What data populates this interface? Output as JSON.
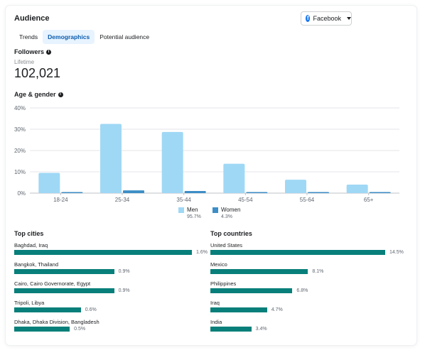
{
  "header": {
    "title": "Audience",
    "source_selector": "Facebook"
  },
  "tabs": [
    {
      "label": "Trends",
      "active": false
    },
    {
      "label": "Demographics",
      "active": true
    },
    {
      "label": "Potential audience",
      "active": false
    }
  ],
  "followers": {
    "title": "Followers",
    "period": "Lifetime",
    "count": "102,021"
  },
  "age_gender": {
    "title": "Age & gender"
  },
  "chart_data": {
    "type": "bar",
    "categories": [
      "18-24",
      "25-34",
      "35-44",
      "45-54",
      "55-64",
      "65+"
    ],
    "series": [
      {
        "name": "Men",
        "values": [
          9.5,
          32.5,
          28.7,
          13.8,
          6.3,
          4.0
        ],
        "color": "#9fd8f5",
        "total": "95.7%"
      },
      {
        "name": "Women",
        "values": [
          0.5,
          1.3,
          1.0,
          0.5,
          0.25,
          0.25
        ],
        "color": "#3d8ec6",
        "total": "4.3%"
      }
    ],
    "yticks": [
      "0%",
      "10%",
      "20%",
      "30%",
      "40%"
    ],
    "ylim": [
      0,
      40
    ],
    "grid": true
  },
  "top_cities": {
    "title": "Top cities",
    "items": [
      {
        "label": "Baghdad, Iraq",
        "value": 1.6,
        "text": "1.6%"
      },
      {
        "label": "Bangkok, Thailand",
        "value": 0.9,
        "text": "0.9%"
      },
      {
        "label": "Cairo, Cairo Governorate, Egypt",
        "value": 0.9,
        "text": "0.9%"
      },
      {
        "label": "Tripoli, Libya",
        "value": 0.6,
        "text": "0.6%"
      },
      {
        "label": "Dhaka, Dhaka Division, Bangladesh",
        "value": 0.5,
        "text": "0.5%"
      }
    ]
  },
  "top_countries": {
    "title": "Top countries",
    "items": [
      {
        "label": "United States",
        "value": 14.5,
        "text": "14.5%"
      },
      {
        "label": "Mexico",
        "value": 8.1,
        "text": "8.1%"
      },
      {
        "label": "Philippines",
        "value": 6.8,
        "text": "6.8%"
      },
      {
        "label": "Iraq",
        "value": 4.7,
        "text": "4.7%"
      },
      {
        "label": "India",
        "value": 3.4,
        "text": "3.4%"
      }
    ]
  }
}
